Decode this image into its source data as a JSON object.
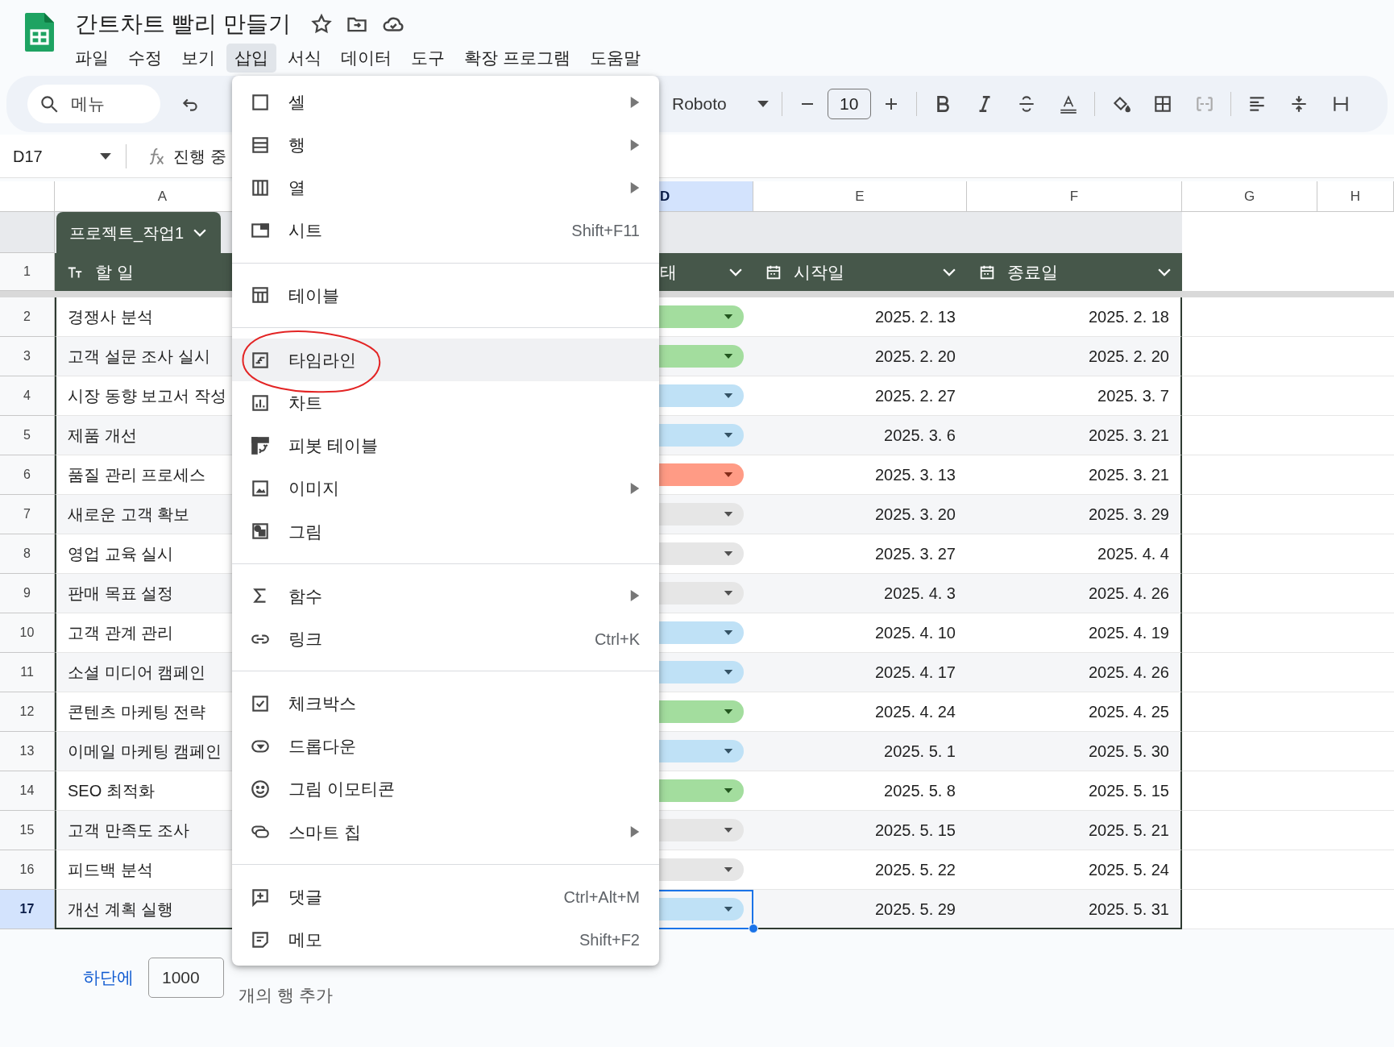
{
  "app": {
    "title": "간트차트 빨리 만들기"
  },
  "menubar": [
    {
      "label": "파일",
      "selected": false
    },
    {
      "label": "수정",
      "selected": false
    },
    {
      "label": "보기",
      "selected": false
    },
    {
      "label": "삽입",
      "selected": true
    },
    {
      "label": "서식",
      "selected": false
    },
    {
      "label": "데이터",
      "selected": false
    },
    {
      "label": "도구",
      "selected": false
    },
    {
      "label": "확장 프로그램",
      "selected": false
    },
    {
      "label": "도움말",
      "selected": false
    }
  ],
  "toolbar": {
    "search_placeholder": "메뉴",
    "font": "Roboto",
    "font_size": "10"
  },
  "formula_bar": {
    "cell_ref": "D17",
    "content": "진행 중"
  },
  "columns": [
    {
      "label": "A",
      "selected": false
    },
    {
      "label": "D",
      "selected": true
    },
    {
      "label": "E",
      "selected": false
    },
    {
      "label": "F",
      "selected": false
    },
    {
      "label": "G",
      "selected": false
    },
    {
      "label": "H",
      "selected": false
    }
  ],
  "table": {
    "name": "프로젝트_작업1",
    "header_row_number": "1",
    "headers": [
      {
        "label": "할 일",
        "kind": "text"
      },
      {
        "label": "태",
        "kind": "dropdown"
      },
      {
        "label": "시작일",
        "kind": "date"
      },
      {
        "label": "종료일",
        "kind": "date"
      }
    ],
    "rows": [
      {
        "number": "2",
        "task": "경쟁사 분석",
        "color": "#a3dd9e",
        "start": "2025. 2. 13",
        "end": "2025. 2. 18",
        "selected": false
      },
      {
        "number": "3",
        "task": "고객 설문 조사 실시",
        "color": "#a3dd9e",
        "start": "2025. 2. 20",
        "end": "2025. 2. 20",
        "selected": false
      },
      {
        "number": "4",
        "task": "시장 동향 보고서 작성",
        "color": "#bfe1f6",
        "start": "2025. 2. 27",
        "end": "2025. 3. 7",
        "selected": false
      },
      {
        "number": "5",
        "task": "제품 개선",
        "color": "#bfe1f6",
        "start": "2025. 3. 6",
        "end": "2025. 3. 21",
        "selected": false
      },
      {
        "number": "6",
        "task": "품질 관리 프로세스",
        "color": "#ff9b85",
        "start": "2025. 3. 13",
        "end": "2025. 3. 21",
        "selected": false
      },
      {
        "number": "7",
        "task": "새로운 고객 확보",
        "color": "#e6e6e6",
        "start": "2025. 3. 20",
        "end": "2025. 3. 29",
        "selected": false
      },
      {
        "number": "8",
        "task": "영업 교육 실시",
        "color": "#e6e6e6",
        "start": "2025. 3. 27",
        "end": "2025. 4. 4",
        "selected": false
      },
      {
        "number": "9",
        "task": "판매 목표 설정",
        "color": "#e6e6e6",
        "start": "2025. 4. 3",
        "end": "2025. 4. 26",
        "selected": false
      },
      {
        "number": "10",
        "task": "고객 관계 관리",
        "color": "#bfe1f6",
        "start": "2025. 4. 10",
        "end": "2025. 4. 19",
        "selected": false
      },
      {
        "number": "11",
        "task": "소셜 미디어 캠페인",
        "color": "#bfe1f6",
        "start": "2025. 4. 17",
        "end": "2025. 4. 26",
        "selected": false
      },
      {
        "number": "12",
        "task": "콘텐츠 마케팅 전략",
        "color": "#a3dd9e",
        "start": "2025. 4. 24",
        "end": "2025. 4. 25",
        "selected": false
      },
      {
        "number": "13",
        "task": "이메일 마케팅 캠페인",
        "color": "#bfe1f6",
        "start": "2025. 5. 1",
        "end": "2025. 5. 30",
        "selected": false
      },
      {
        "number": "14",
        "task": "SEO 최적화",
        "color": "#a3dd9e",
        "start": "2025. 5. 8",
        "end": "2025. 5. 15",
        "selected": false
      },
      {
        "number": "15",
        "task": "고객 만족도 조사",
        "color": "#e6e6e6",
        "start": "2025. 5. 15",
        "end": "2025. 5. 21",
        "selected": false
      },
      {
        "number": "16",
        "task": "피드백 분석",
        "color": "#e6e6e6",
        "start": "2025. 5. 22",
        "end": "2025. 5. 24",
        "selected": false
      },
      {
        "number": "17",
        "task": "개선 계획 실행",
        "color": "#bfe1f6",
        "start": "2025. 5. 29",
        "end": "2025. 5. 31",
        "selected": true
      }
    ]
  },
  "add_rows": {
    "link": "하단에",
    "count": "1000",
    "suffix": "개의 행 추가"
  },
  "insert_menu": [
    {
      "kind": "item",
      "label": "셀",
      "submenu": true,
      "highlighted": false,
      "circled": false
    },
    {
      "kind": "item",
      "label": "행",
      "submenu": true,
      "highlighted": false,
      "circled": false
    },
    {
      "kind": "item",
      "label": "열",
      "submenu": true,
      "highlighted": false,
      "circled": false
    },
    {
      "kind": "item",
      "label": "시트",
      "shortcut": "Shift+F11",
      "submenu": false,
      "highlighted": false,
      "circled": false
    },
    {
      "kind": "divider"
    },
    {
      "kind": "item",
      "label": "테이블",
      "submenu": false,
      "highlighted": false,
      "circled": false
    },
    {
      "kind": "divider"
    },
    {
      "kind": "item",
      "label": "타임라인",
      "submenu": false,
      "highlighted": true,
      "circled": true
    },
    {
      "kind": "item",
      "label": "차트",
      "submenu": false,
      "highlighted": false,
      "circled": false
    },
    {
      "kind": "item",
      "label": "피봇 테이블",
      "submenu": false,
      "highlighted": false,
      "circled": false
    },
    {
      "kind": "item",
      "label": "이미지",
      "submenu": true,
      "highlighted": false,
      "circled": false
    },
    {
      "kind": "item",
      "label": "그림",
      "submenu": false,
      "highlighted": false,
      "circled": false
    },
    {
      "kind": "divider"
    },
    {
      "kind": "item",
      "label": "함수",
      "submenu": true,
      "highlighted": false,
      "circled": false
    },
    {
      "kind": "item",
      "label": "링크",
      "shortcut": "Ctrl+K",
      "submenu": false,
      "highlighted": false,
      "circled": false
    },
    {
      "kind": "divider"
    },
    {
      "kind": "item",
      "label": "체크박스",
      "submenu": false,
      "highlighted": false,
      "circled": false
    },
    {
      "kind": "item",
      "label": "드롭다운",
      "submenu": false,
      "highlighted": false,
      "circled": false
    },
    {
      "kind": "item",
      "label": "그림 이모티콘",
      "submenu": false,
      "highlighted": false,
      "circled": false
    },
    {
      "kind": "item",
      "label": "스마트 칩",
      "submenu": true,
      "highlighted": false,
      "circled": false
    },
    {
      "kind": "divider"
    },
    {
      "kind": "item",
      "label": "댓글",
      "shortcut": "Ctrl+Alt+M",
      "submenu": false,
      "highlighted": false,
      "circled": false
    },
    {
      "kind": "item",
      "label": "메모",
      "shortcut": "Shift+F2",
      "submenu": false,
      "highlighted": false,
      "circled": false
    }
  ]
}
